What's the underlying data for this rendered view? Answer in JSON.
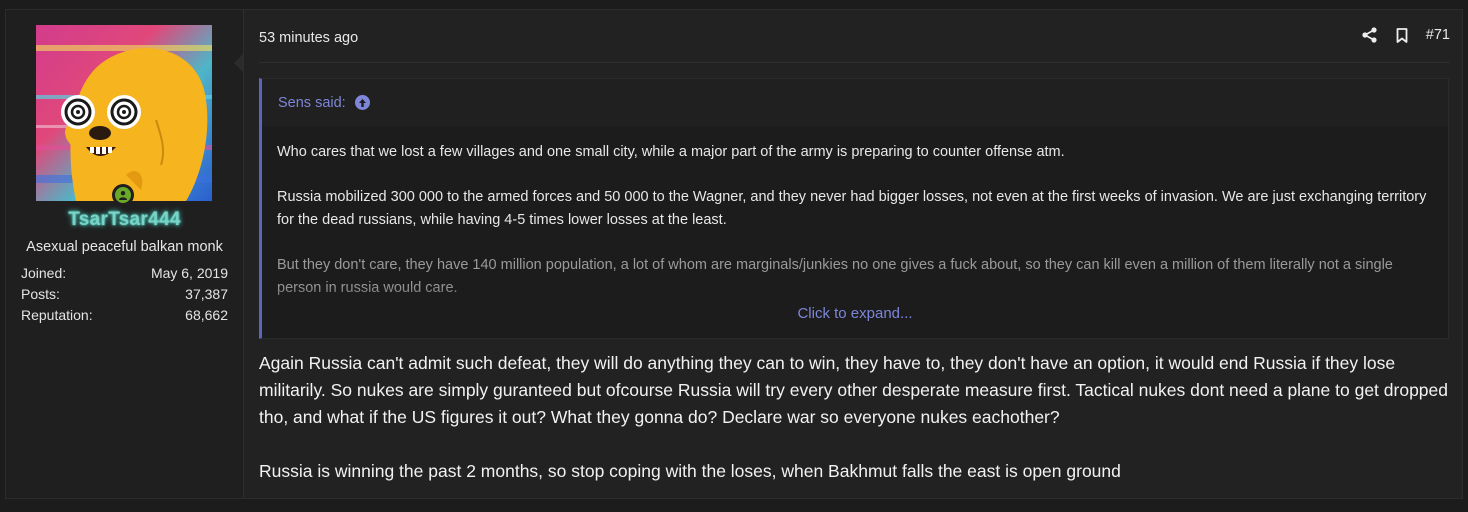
{
  "user": {
    "username": "TsarTsar444",
    "title": "Asexual peaceful balkan monk",
    "stats": [
      {
        "label": "Joined:",
        "value": "May 6, 2019"
      },
      {
        "label": "Posts:",
        "value": "37,387"
      },
      {
        "label": "Reputation:",
        "value": "68,662"
      }
    ],
    "online_icon": "user-online-icon",
    "colors": {
      "username": "#7ad3c5",
      "online": "#6aa827"
    }
  },
  "post": {
    "time": "53 minutes ago",
    "number": "#71",
    "share_icon": "share-icon",
    "bookmark_icon": "bookmark-icon"
  },
  "quote": {
    "author_line": "Sens said:",
    "jump_icon": "arrow-up-circle-icon",
    "paragraphs": [
      "Who cares that we lost a few villages and one small city, while a major part of the army is preparing to counter offense atm.",
      "Russia mobilized 300 000 to the armed forces and 50 000 to the Wagner, and they never had bigger losses, not even at the first weeks of invasion. We are just exchanging territory for the dead russians, while having 4-5 times lower losses at the least.",
      "But they don't care, they have 140 million population, a lot of whom are marginals/junkies no one gives a fuck about, so they can kill even a million of them literally not a single person in russia would care."
    ],
    "expand_label": "Click to expand...",
    "accent_color": "#5c64c0"
  },
  "message": {
    "paragraphs": [
      "Again Russia can't admit such defeat, they will do anything they can to win, they have to, they don't have an option, it would end Russia if they lose militarily. So nukes are simply guranteed but ofcourse Russia will try every other desperate measure first. Tactical nukes dont need a plane to get dropped tho, and what if the US figures it out? What they gonna do? Declare war so everyone nukes eachother?",
      "Russia is winning the past 2 months, so stop coping with the loses, when Bakhmut falls the east is open ground"
    ]
  }
}
